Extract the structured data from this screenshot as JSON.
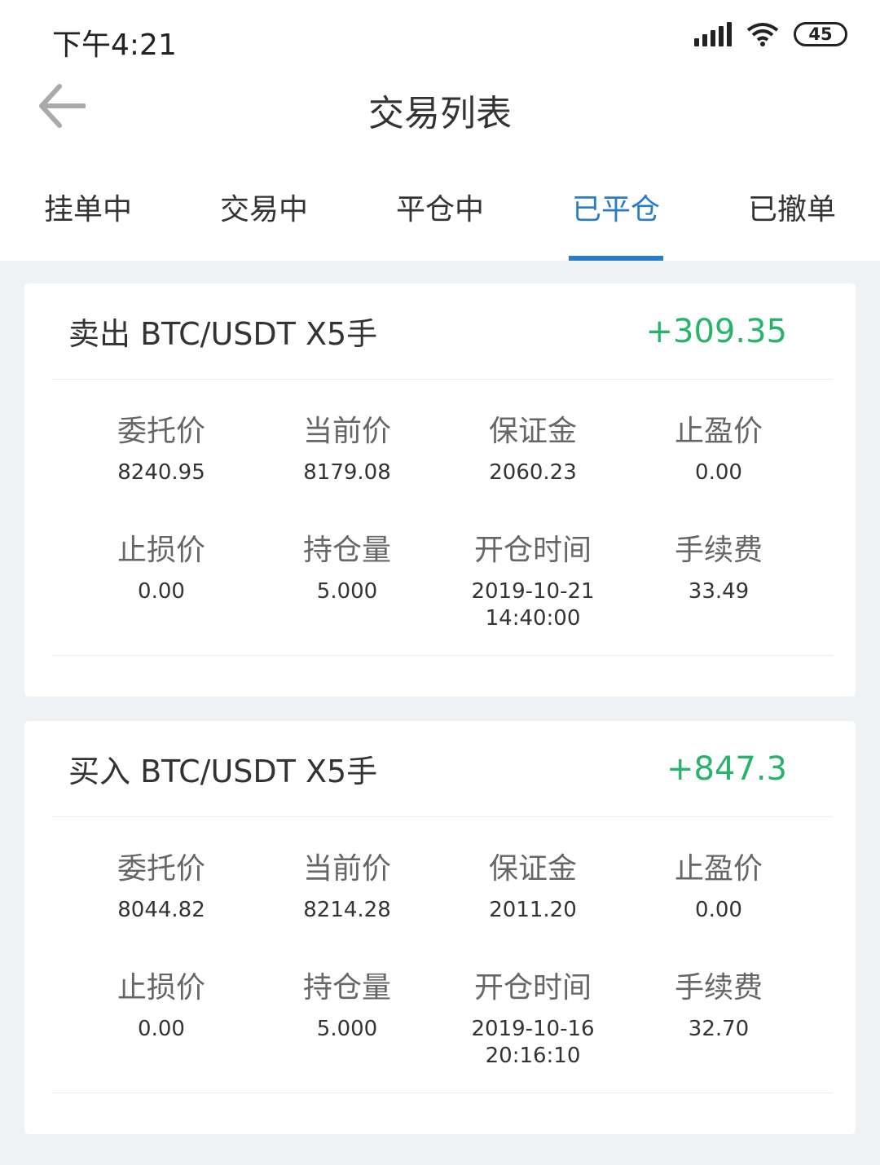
{
  "status_bar": {
    "time": "下午4:21",
    "battery": "45"
  },
  "header": {
    "title": "交易列表"
  },
  "tabs": [
    {
      "label": "挂单中",
      "active": false
    },
    {
      "label": "交易中",
      "active": false
    },
    {
      "label": "平仓中",
      "active": false
    },
    {
      "label": "已平仓",
      "active": true
    },
    {
      "label": "已撤单",
      "active": false
    }
  ],
  "colors": {
    "accent": "#2a7cc9",
    "profit": "#27b36a"
  },
  "orders": [
    {
      "title": "卖出 BTC/USDT X5手",
      "profit": "+309.35",
      "fields": [
        {
          "label": "委托价",
          "value": "8240.95"
        },
        {
          "label": "当前价",
          "value": "8179.08"
        },
        {
          "label": "保证金",
          "value": "2060.23"
        },
        {
          "label": "止盈价",
          "value": "0.00"
        },
        {
          "label": "止损价",
          "value": "0.00"
        },
        {
          "label": "持仓量",
          "value": "5.000"
        },
        {
          "label": "开仓时间",
          "value": "2019-10-21\n14:40:00"
        },
        {
          "label": "手续费",
          "value": "33.49"
        }
      ]
    },
    {
      "title": "买入 BTC/USDT X5手",
      "profit": "+847.3",
      "fields": [
        {
          "label": "委托价",
          "value": "8044.82"
        },
        {
          "label": "当前价",
          "value": "8214.28"
        },
        {
          "label": "保证金",
          "value": "2011.20"
        },
        {
          "label": "止盈价",
          "value": "0.00"
        },
        {
          "label": "止损价",
          "value": "0.00"
        },
        {
          "label": "持仓量",
          "value": "5.000"
        },
        {
          "label": "开仓时间",
          "value": "2019-10-16\n20:16:10"
        },
        {
          "label": "手续费",
          "value": "32.70"
        }
      ]
    }
  ]
}
